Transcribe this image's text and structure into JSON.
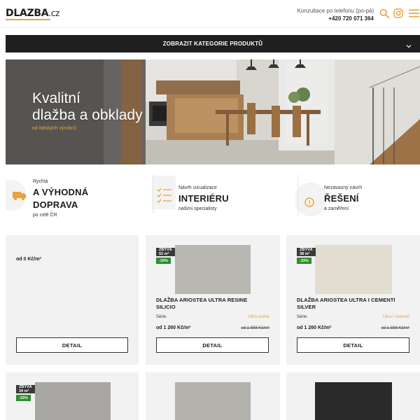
{
  "header": {
    "logo_main": "DLAZBA",
    "logo_suffix": ".cz",
    "contact_label": "Konzultace po telefonu (po-pá)",
    "contact_phone": "+420 720 071 364"
  },
  "catbar": {
    "label": "ZOBRAZIT KATEGORIE PRODUKTŮ"
  },
  "hero": {
    "title_line1": "Kvalitní",
    "title_line2": "dlažba a obklady",
    "subtitle": "od italských výrobců"
  },
  "features": [
    {
      "small": "Rychlá",
      "big1": "A VÝHODNÁ",
      "big2": "DOPRAVA",
      "tail": "po celé ČR",
      "icon": "truck-icon"
    },
    {
      "small": "Návrh vizualizace",
      "big1": "INTERIÉRU",
      "tail": "našimi specialisty",
      "icon": "checklist-icon"
    },
    {
      "small": "Nezávazný návrh",
      "big1": "ŘEŠENÍ",
      "tail": "a zaměření",
      "icon": "location-pin-icon"
    }
  ],
  "products": [
    {
      "price": "od 0 Kč/m²",
      "detail": "DETAIL"
    },
    {
      "stock": "ZBÝVÁ 52 m²",
      "discount": "-33%",
      "name1": "DLAŽBA ARIOSTEA ULTRA RESINE",
      "name2": "SILICIO",
      "series_label": "Série:",
      "series": "Ultra resine",
      "price": "od 1 260 Kč/m²",
      "old_price": "od 1 888 Kč/m²",
      "detail": "DETAIL",
      "swatch": "#b9b7b1"
    },
    {
      "stock": "ZBÝVÁ 38 m²",
      "discount": "-33%",
      "name1": "DLAŽBA ARIOSTEA ULTRA I CEMENTI",
      "name2": "SILVER",
      "series_label": "Série:",
      "series": "Ultra i cementi",
      "price": "od 1 260 Kč/m²",
      "old_price": "od 1 888 Kč/m²",
      "detail": "DETAIL",
      "swatch": "#e2ddd0"
    },
    {
      "stock": "ZBÝVÁ 34 m²",
      "discount": "-33%",
      "swatch": "#a8a7a3"
    },
    {
      "swatch": "#b3b2ad"
    },
    {
      "swatch": "#2a2a2a"
    }
  ],
  "colors": {
    "accent": "#e8a33d",
    "dark": "#1f1f1f",
    "discount": "#2e8b2e",
    "card_bg": "#f2f2f2"
  }
}
